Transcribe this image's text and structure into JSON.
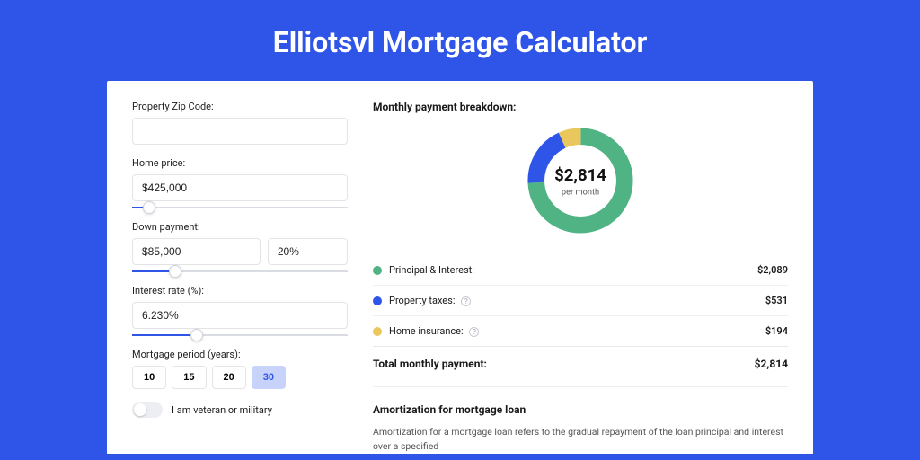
{
  "title": "Elliotsvl Mortgage Calculator",
  "form": {
    "zip": {
      "label": "Property Zip Code:",
      "value": ""
    },
    "home_price": {
      "label": "Home price:",
      "value": "$425,000",
      "slider_pct": 8
    },
    "down_payment": {
      "label": "Down payment:",
      "amount": "$85,000",
      "percent": "20%",
      "slider_pct": 20
    },
    "interest": {
      "label": "Interest rate (%):",
      "value": "6.230%",
      "slider_pct": 30
    },
    "period": {
      "label": "Mortgage period (years):",
      "options": [
        "10",
        "15",
        "20",
        "30"
      ],
      "selected_index": 3
    },
    "veteran": {
      "label": "I am veteran or military",
      "value": false
    }
  },
  "breakdown": {
    "title": "Monthly payment breakdown:",
    "center_amount": "$2,814",
    "center_sub": "per month",
    "items": [
      {
        "color": "green",
        "label": "Principal & Interest:",
        "value": "$2,089",
        "info": false
      },
      {
        "color": "blue",
        "label": "Property taxes:",
        "value": "$531",
        "info": true
      },
      {
        "color": "yellow",
        "label": "Home insurance:",
        "value": "$194",
        "info": true
      }
    ],
    "total_label": "Total monthly payment:",
    "total_value": "$2,814"
  },
  "amort": {
    "title": "Amortization for mortgage loan",
    "text": "Amortization for a mortgage loan refers to the gradual repayment of the loan principal and interest over a specified"
  },
  "chart_data": {
    "type": "pie",
    "title": "Monthly payment breakdown",
    "series": [
      {
        "name": "Principal & Interest",
        "value": 2089,
        "color": "#50b383"
      },
      {
        "name": "Property taxes",
        "value": 531,
        "color": "#2f55e8"
      },
      {
        "name": "Home insurance",
        "value": 194,
        "color": "#e9c75d"
      }
    ],
    "total": 2814,
    "donut_inner_ratio": 0.65
  }
}
